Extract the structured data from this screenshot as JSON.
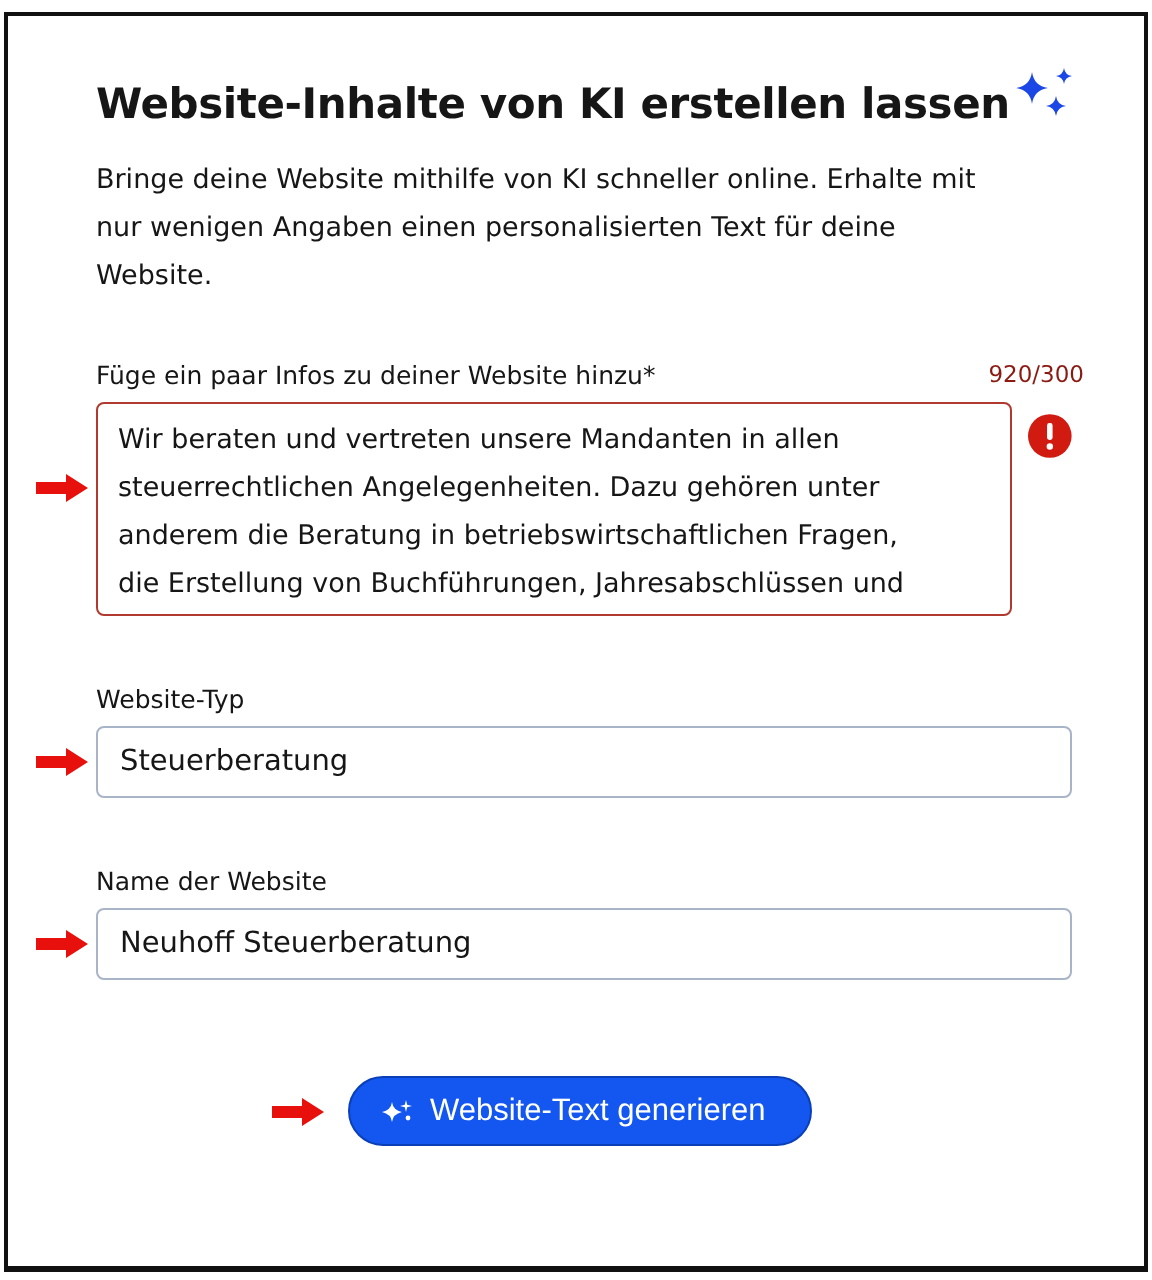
{
  "title": "Website-Inhalte von KI erstellen lassen",
  "description": "Bringe deine Website mithilfe von KI schneller online. Erhalte mit nur wenigen Angaben einen personalisierten Text für deine Website.",
  "fields": [
    {
      "kind": "textarea",
      "label": "Füge ein paar Infos zu deiner Website hinzu*",
      "counter": "920/300",
      "error": true,
      "value_lines": [
        "Wir beraten und vertreten unsere Mandanten in allen",
        "steuerrechtlichen Angelegenheiten. Dazu gehören unter",
        "anderem die Beratung in betriebswirtschaftlichen Fragen,",
        "die Erstellung von Buchführungen, Jahresabschlüssen und"
      ]
    },
    {
      "kind": "input",
      "label": "Website-Typ",
      "value": "Steuerberatung"
    },
    {
      "kind": "input",
      "label": "Name der Website",
      "value": "Neuhoff Steuerberatung"
    }
  ],
  "button": {
    "label": "Website-Text generieren"
  }
}
